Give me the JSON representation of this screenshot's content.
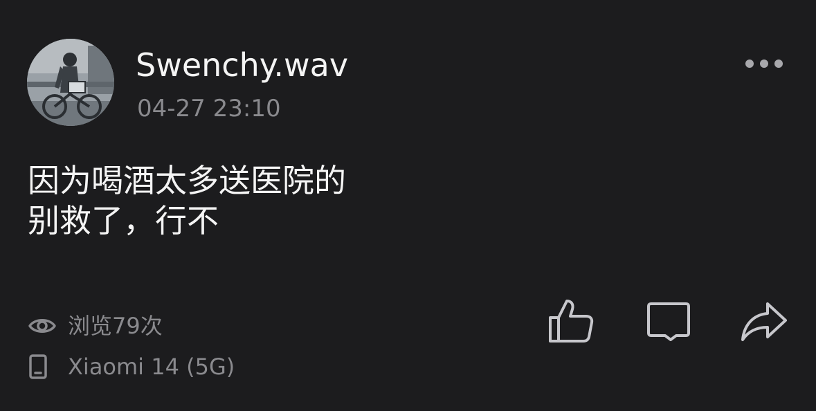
{
  "post": {
    "author": {
      "name": "Swenchy.wav",
      "avatar": "avatar-image"
    },
    "timestamp": "04-27 23:10",
    "content": {
      "line1": "因为喝酒太多送医院的",
      "line2": "别救了，行不"
    },
    "views_text": "浏览79次",
    "device_text": "Xiaomi 14 (5G)"
  },
  "icons": {
    "more": "more-dots-icon",
    "views": "eye-icon",
    "device": "phone-icon",
    "like": "thumbs-up-icon",
    "comment": "comment-icon",
    "share": "share-icon"
  },
  "colors": {
    "background": "#1c1c1e",
    "primary_text": "#f4f4f4",
    "secondary_text": "#8a8a8e",
    "icon": "#c7c7cc"
  }
}
